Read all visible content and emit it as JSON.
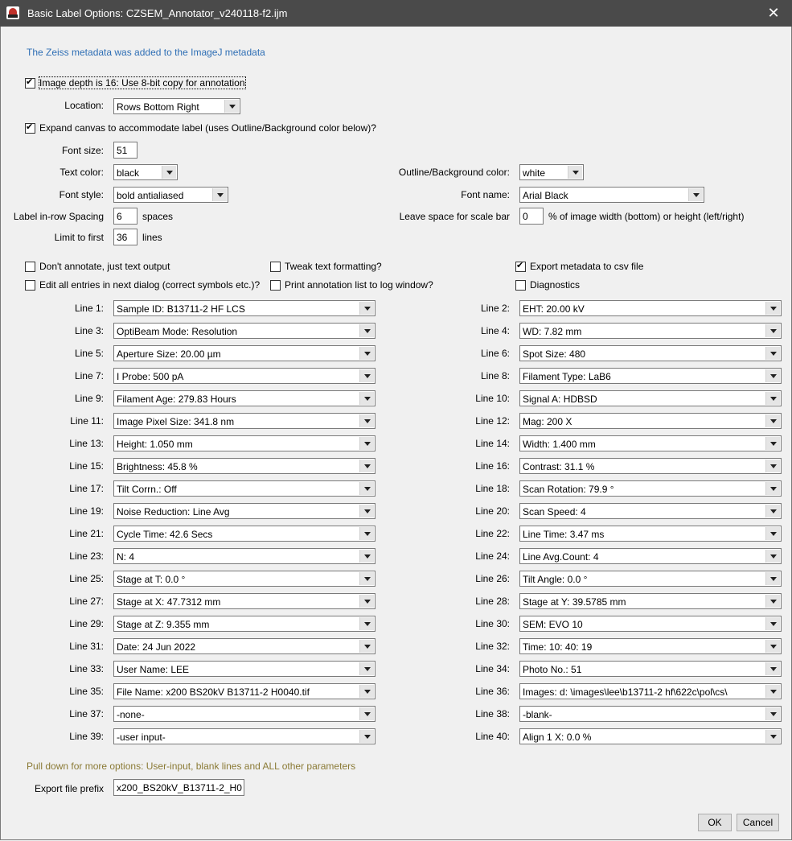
{
  "window": {
    "title": "Basic Label Options: CZSEM_Annotator_v240118-f2.ijm",
    "app_icon": "imagej-microscope-icon",
    "close_icon": "close-icon",
    "close_glyph": "✕"
  },
  "info_message": "The Zeiss metadata was added to the ImageJ metadata",
  "image_depth": {
    "label": "Image depth is 16: Use 8-bit copy for annotation",
    "checked": true
  },
  "location": {
    "label": "Location:",
    "value": "Rows Bottom Right"
  },
  "expand_canvas": {
    "label": "Expand canvas to accommodate label (uses Outline/Background color below)?",
    "checked": true
  },
  "font_size": {
    "label": "Font size:",
    "value": "51"
  },
  "text_color": {
    "label": "Text color:",
    "value": "black"
  },
  "outline_color": {
    "label": "Outline/Background color:",
    "value": "white"
  },
  "font_style": {
    "label": "Font style:",
    "value": "bold antialiased"
  },
  "font_name": {
    "label": "Font name:",
    "value": "Arial Black"
  },
  "row_spacing": {
    "label": "Label in-row Spacing",
    "value": "6",
    "unit": "spaces"
  },
  "scale_bar_space": {
    "label": "Leave space for scale bar",
    "value": "0",
    "unit": "% of image width (bottom) or height (left/right)"
  },
  "limit_first": {
    "label": "Limit to first",
    "value": "36",
    "unit": "lines"
  },
  "options": {
    "dont_annotate": {
      "label": "Don't annotate, just text output",
      "checked": false
    },
    "tweak_text": {
      "label": "Tweak text formatting?",
      "checked": false
    },
    "export_csv": {
      "label": "Export metadata to csv file",
      "checked": true
    },
    "edit_entries": {
      "label": "Edit all entries in next dialog (correct symbols etc.)?",
      "checked": false
    },
    "print_list": {
      "label": "Print annotation list to log window?",
      "checked": false
    },
    "diagnostics": {
      "label": "Diagnostics",
      "checked": false
    }
  },
  "lines": [
    {
      "label": "Line 1:",
      "value": "Sample ID: B13711-2 HF LCS"
    },
    {
      "label": "Line 2:",
      "value": "EHT: 20.00 kV"
    },
    {
      "label": "Line 3:",
      "value": "OptiBeam Mode: Resolution"
    },
    {
      "label": "Line 4:",
      "value": "WD: 7.82 mm"
    },
    {
      "label": "Line 5:",
      "value": "Aperture Size: 20.00 µm"
    },
    {
      "label": "Line 6:",
      "value": "Spot Size: 480"
    },
    {
      "label": "Line 7:",
      "value": "I Probe: 500 pA"
    },
    {
      "label": "Line 8:",
      "value": "Filament Type: LaB6"
    },
    {
      "label": "Line 9:",
      "value": "Filament Age: 279.83 Hours"
    },
    {
      "label": "Line 10:",
      "value": "Signal A: HDBSD"
    },
    {
      "label": "Line 11:",
      "value": "Image Pixel Size: 341.8 nm"
    },
    {
      "label": "Line 12:",
      "value": "Mag: 200 X"
    },
    {
      "label": "Line 13:",
      "value": "Height: 1.050 mm"
    },
    {
      "label": "Line 14:",
      "value": "Width: 1.400 mm"
    },
    {
      "label": "Line 15:",
      "value": "Brightness: 45.8 %"
    },
    {
      "label": "Line 16:",
      "value": "Contrast: 31.1 %"
    },
    {
      "label": "Line 17:",
      "value": "Tilt Corrn.: Off"
    },
    {
      "label": "Line 18:",
      "value": "Scan Rotation: 79.9 °"
    },
    {
      "label": "Line 19:",
      "value": "Noise Reduction: Line Avg"
    },
    {
      "label": "Line 20:",
      "value": "Scan Speed: 4"
    },
    {
      "label": "Line 21:",
      "value": "Cycle Time: 42.6 Secs"
    },
    {
      "label": "Line 22:",
      "value": "Line Time: 3.47 ms"
    },
    {
      "label": "Line 23:",
      "value": "N: 4"
    },
    {
      "label": "Line 24:",
      "value": "Line Avg.Count: 4"
    },
    {
      "label": "Line 25:",
      "value": "Stage at T: 0.0 °"
    },
    {
      "label": "Line 26:",
      "value": "Tilt Angle: 0.0 °"
    },
    {
      "label": "Line 27:",
      "value": "Stage at X: 47.7312 mm"
    },
    {
      "label": "Line 28:",
      "value": "Stage at Y: 39.5785 mm"
    },
    {
      "label": "Line 29:",
      "value": "Stage at Z: 9.355 mm"
    },
    {
      "label": "Line 30:",
      "value": "SEM: EVO 10"
    },
    {
      "label": "Line 31:",
      "value": "Date: 24 Jun 2022"
    },
    {
      "label": "Line 32:",
      "value": "Time: 10: 40: 19"
    },
    {
      "label": "Line 33:",
      "value": "User Name: LEE"
    },
    {
      "label": "Line 34:",
      "value": "Photo No.: 51"
    },
    {
      "label": "Line 35:",
      "value": "File Name: x200 BS20kV B13711-2 H0040.tif"
    },
    {
      "label": "Line 36:",
      "value": "Images: d: \\images\\lee\\b13711-2 hf\\622c\\pol\\cs\\"
    },
    {
      "label": "Line 37:",
      "value": "-none-"
    },
    {
      "label": "Line 38:",
      "value": "-blank-"
    },
    {
      "label": "Line 39:",
      "value": "-user input-"
    },
    {
      "label": "Line 40:",
      "value": "Align 1 X: 0.0 %"
    }
  ],
  "hint": "Pull down for more options: User-input, blank lines and ALL other parameters",
  "export_prefix": {
    "label": "Export file prefix",
    "value": "x200_BS20kV_B13711-2_H0"
  },
  "buttons": {
    "ok": "OK",
    "cancel": "Cancel"
  },
  "colors": {
    "titlebar": "#4a4a4a",
    "info_text": "#2f6fb5",
    "hint_text": "#8a7a35",
    "background": "#f0f0f0"
  }
}
